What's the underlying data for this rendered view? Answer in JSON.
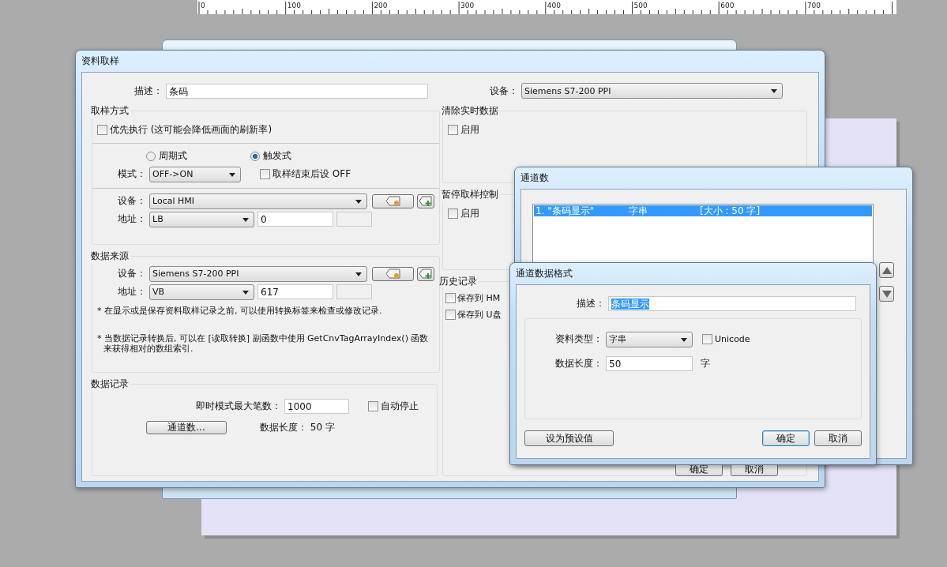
{
  "ruler": {
    "labels": [
      "0",
      "100",
      "200",
      "300",
      "400",
      "500",
      "600",
      "700"
    ]
  },
  "main_dialog": {
    "title": "资料取样",
    "description": {
      "label": "描述：",
      "value": "条码"
    },
    "device": {
      "label": "设备：",
      "value": "Siemens S7-200 PPI"
    },
    "sampling_mode": {
      "title": "取样方式",
      "priority": {
        "label": "优先执行 (这可能会降低画面的刷新率)",
        "checked": false
      },
      "modes": [
        {
          "label": "周期式",
          "selected": false
        },
        {
          "label": "触发式",
          "selected": true
        }
      ],
      "mode": {
        "label": "模式：",
        "value": "OFF->ON"
      },
      "set_off": {
        "label": "取样结束后设 OFF",
        "checked": false
      },
      "device": {
        "label": "设备：",
        "value": "Local HMI"
      },
      "address": {
        "label": "地址：",
        "type": "LB",
        "value": "0"
      }
    },
    "data_source": {
      "title": "数据来源",
      "device": {
        "label": "设备：",
        "value": "Siemens S7-200 PPI"
      },
      "address": {
        "label": "地址：",
        "type": "VB",
        "value": "617"
      },
      "notes": [
        "* 在显示或是保存资料取样记录之前, 可以使用转换标签来检查或修改记录.",
        "* 当数据记录转换后, 可以在 [读取转换] 副函数中使用 GetCnvTagArrayIndex() 函数来获得相对的数组索引."
      ]
    },
    "data_record": {
      "title": "数据记录",
      "max_label": "即时模式最大笔数：",
      "max_value": "1000",
      "auto_stop": {
        "label": "自动停止",
        "checked": false
      },
      "channels_button": "通道数...",
      "data_length": "数据长度： 50 字"
    },
    "clear_realtime": {
      "title": "清除实时数据",
      "enable": {
        "label": "启用",
        "checked": false
      }
    },
    "pause_control": {
      "title": "暂停取样控制",
      "enable": {
        "label": "启用",
        "checked": false
      }
    },
    "history": {
      "title": "历史记录",
      "options": [
        {
          "label": "保存到 HM",
          "checked": false
        },
        {
          "label": "保存到 U盘",
          "checked": false
        }
      ]
    }
  },
  "channels_dialog": {
    "title": "通道数",
    "items": [
      {
        "name": "1. \"条码显示\"",
        "type": "字串",
        "size": "[大小 : 50 字]",
        "selected": true
      }
    ],
    "buttons": [
      "确定",
      "取消"
    ]
  },
  "format_dialog": {
    "title": "通道数据格式",
    "description": {
      "label": "描述：",
      "value": "条码显示",
      "text_selected": true
    },
    "data_type": {
      "label": "资料类型：",
      "value": "字串"
    },
    "unicode": {
      "label": "Unicode",
      "checked": false
    },
    "data_length": {
      "label": "数据长度：",
      "value": "50",
      "unit": "字"
    },
    "buttons": [
      {
        "label": "设为预设值",
        "default": false
      },
      {
        "label": "确定",
        "default": true
      },
      {
        "label": "取消",
        "default": false
      }
    ]
  }
}
